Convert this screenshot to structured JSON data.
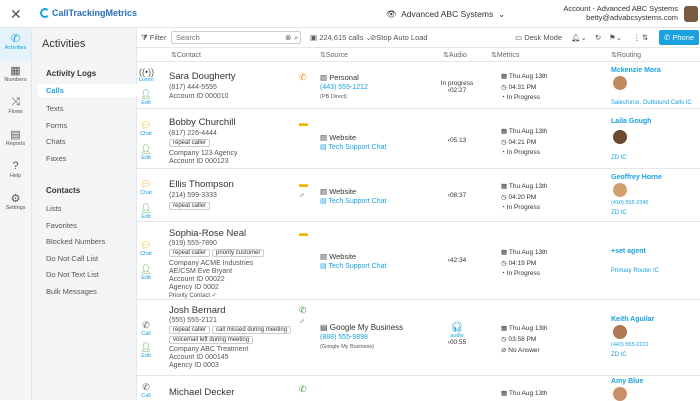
{
  "app": {
    "logo": "CallTrackingMetrics",
    "account_switch": "Advanced ABC Systems",
    "account_label": "Account - Advanced ABC Systems",
    "email": "betty@advabcsystems.com"
  },
  "nav": [
    {
      "label": "Activities",
      "icon": "phone-icon"
    },
    {
      "label": "Numbers",
      "icon": "grid-icon"
    },
    {
      "label": "Flows",
      "icon": "shuffle-icon"
    },
    {
      "label": "Reports",
      "icon": "chart-icon"
    },
    {
      "label": "Help",
      "icon": "help-icon"
    },
    {
      "label": "Settings",
      "icon": "gear-icon"
    }
  ],
  "sidebar": {
    "title": "Activities",
    "logs_title": "Activity Logs",
    "logs": [
      "Calls",
      "Texts",
      "Forms",
      "Chats",
      "Faxes"
    ],
    "contacts_title": "Contacts",
    "contacts": [
      "Lists",
      "Favorites",
      "Blocked Numbers",
      "Do Not Call List",
      "Do Not Text List",
      "Bulk Messages"
    ]
  },
  "toolbar": {
    "filter": "Filter",
    "search_placeholder": "Search",
    "calls_count": "224,615 calls",
    "stop_auto_load": "Stop Auto Load",
    "desk_mode": "Desk Mode",
    "phone": "Phone"
  },
  "columns": {
    "contact": "Contact",
    "source": "Source",
    "audio": "Audio",
    "metrics": "Metrics",
    "routing": "Routing"
  },
  "rows": [
    {
      "type": "Listen",
      "edit": "Edit",
      "name": "Sara Dougherty",
      "phone": "(817) 444-5555",
      "account": "Account ID 000010",
      "source": "Personal",
      "source_num": "(443) 555-1212",
      "source_small": "(PB Direct)",
      "audio_status": "In progress",
      "audio": "02:27",
      "date": "Thu Aug 13th",
      "time": "04:31 PM",
      "status": "In Progress",
      "route_name": "Mckenzie Mora",
      "route_sub": "Salesforce, Outbound Calls IC"
    },
    {
      "type": "Chat",
      "edit": "Edit",
      "name": "Bobby Churchill",
      "phone": "(817) 226-4444",
      "tag1": "repeat caller",
      "company": "Company 123 Agency",
      "account": "Account ID 000123",
      "source": "Website",
      "source_sub": "Tech Support Chat",
      "audio": "05:13",
      "date": "Thu Aug 13th",
      "time": "04:21 PM",
      "status": "In Progress",
      "route_name": "Laila Gough",
      "route_sub": "ZD IC"
    },
    {
      "type": "Chat",
      "edit": "Edit",
      "name": "Ellis Thompson",
      "phone": "(214) 599-3333",
      "tag1": "repeat caller",
      "source": "Website",
      "source_sub": "Tech Support Chat",
      "audio": "08:37",
      "date": "Thu Aug 13th",
      "time": "04:20 PM",
      "status": "In Progress",
      "route_name": "Geoffrey Horne",
      "route_num": "(410) 555-2345",
      "route_sub": "ZD IC"
    },
    {
      "type": "Chat",
      "edit": "Edit",
      "name": "Sophia-Rose Neal",
      "phone": "(919) 555-7890",
      "tag1": "repeat caller",
      "tag2": "priority customer",
      "company": "Company ACME Industries",
      "aecsm": "AE/CSM Eve Bryant",
      "account": "Account ID 00022",
      "agency": "Agency ID 0002",
      "priority": "Priority Contact ✓",
      "source": "Website",
      "source_sub": "Tech Support Chat",
      "audio": "42:34",
      "date": "Thu Aug 13th",
      "time": "04:19 PM",
      "status": "In Progress",
      "route_name": "+set agent",
      "route_sub": "Primary Router IC"
    },
    {
      "type": "Call",
      "edit": "Edit",
      "name": "Josh Bernard",
      "phone": "(555) 555-2121",
      "tag1": "repeat caller",
      "tag2": "call missed during meeting",
      "tag3": "voicemail left during meeting",
      "company": "Company ABC Treatment",
      "account": "Account ID 000145",
      "agency": "Agency ID 0003",
      "source": "Google My Business",
      "source_num": "(888) 555-9898",
      "source_small": "(Google My Business)",
      "audio_label": "audio",
      "audio": "00:55",
      "date": "Thu Aug 13th",
      "time": "03:58 PM",
      "status": "No Answer",
      "route_name": "Keith Aguilar",
      "route_num": "(443) 555-2222",
      "route_sub": "ZD IC"
    },
    {
      "type": "Call",
      "name": "Michael Decker",
      "date": "Thu Aug 13th",
      "route_name": "Amy Blue"
    }
  ]
}
